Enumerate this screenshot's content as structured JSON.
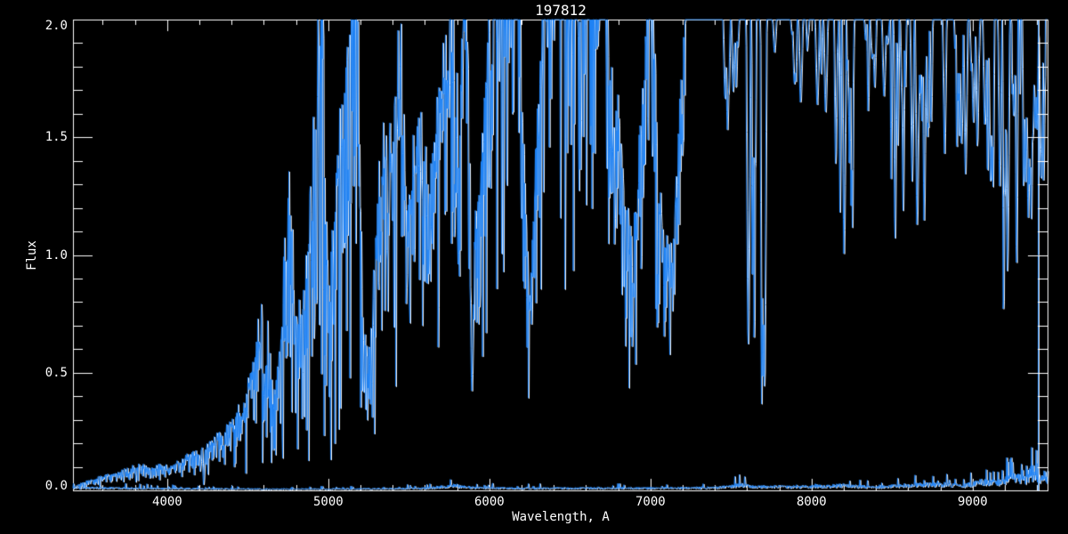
{
  "window": {
    "background_color": "#000000"
  },
  "chart_data": {
    "type": "line",
    "title": "197812",
    "xlabel": "Wavelength, A",
    "ylabel": "Flux",
    "xlim": [
      3415,
      9465
    ],
    "ylim": [
      0,
      2.0
    ],
    "grid": false,
    "legend": null,
    "x_ticks": [
      {
        "value": 4000,
        "label": "4000"
      },
      {
        "value": 5000,
        "label": "5000"
      },
      {
        "value": 6000,
        "label": "6000"
      },
      {
        "value": 7000,
        "label": "7000"
      },
      {
        "value": 8000,
        "label": "8000"
      },
      {
        "value": 9000,
        "label": "9000"
      }
    ],
    "x_minor_step": 200,
    "y_ticks": [
      {
        "value": 0.0,
        "label": "0.0"
      },
      {
        "value": 0.5,
        "label": "0.5"
      },
      {
        "value": 1.0,
        "label": "1.0"
      },
      {
        "value": 1.5,
        "label": "1.5"
      },
      {
        "value": 2.0,
        "label": "2.0"
      }
    ],
    "y_minor_step": 0.1,
    "colors": {
      "background": "#000000",
      "axis": "#FFFFFF",
      "text": "#FFFFFF",
      "spectrum_line": "#1E82F5",
      "underdraw_line": "#FFFFFF"
    },
    "series": [
      {
        "name": "spectrum",
        "clip_max": 2.0,
        "envelope_points": [
          [
            3420,
            0.015
          ],
          [
            3470,
            0.03
          ],
          [
            3540,
            0.045
          ],
          [
            3620,
            0.06
          ],
          [
            3700,
            0.075
          ],
          [
            3780,
            0.095
          ],
          [
            3840,
            0.1
          ],
          [
            3900,
            0.085
          ],
          [
            3950,
            0.105
          ],
          [
            4010,
            0.095
          ],
          [
            4070,
            0.115
          ],
          [
            4130,
            0.14
          ],
          [
            4200,
            0.155
          ],
          [
            4270,
            0.19
          ],
          [
            4340,
            0.23
          ],
          [
            4410,
            0.27
          ],
          [
            4470,
            0.36
          ],
          [
            4530,
            0.48
          ],
          [
            4584,
            0.7
          ],
          [
            4607,
            0.42
          ],
          [
            4626,
            0.7
          ],
          [
            4660,
            0.36
          ],
          [
            4700,
            0.55
          ],
          [
            4761,
            1.3
          ],
          [
            4792,
            0.62
          ],
          [
            4830,
            0.7
          ],
          [
            4880,
            1.05
          ],
          [
            4930,
            1.7
          ],
          [
            4954,
            2.3
          ],
          [
            4978,
            1.1
          ],
          [
            5012,
            0.8
          ],
          [
            5060,
            1.4
          ],
          [
            5120,
            1.85
          ],
          [
            5167,
            2.25
          ],
          [
            5210,
            0.72
          ],
          [
            5252,
            0.54
          ],
          [
            5300,
            1.15
          ],
          [
            5350,
            1.42
          ],
          [
            5400,
            1.28
          ],
          [
            5448,
            1.92
          ],
          [
            5482,
            1.05
          ],
          [
            5530,
            1.35
          ],
          [
            5580,
            1.42
          ],
          [
            5630,
            1.22
          ],
          [
            5680,
            1.52
          ],
          [
            5760,
            1.92
          ],
          [
            5812,
            1.42
          ],
          [
            5850,
            2.35
          ],
          [
            5888,
            0.9
          ],
          [
            5920,
            1.1
          ],
          [
            5970,
            1.62
          ],
          [
            6020,
            2.05
          ],
          [
            6080,
            2.55
          ],
          [
            6158,
            2.85
          ],
          [
            6210,
            1.35
          ],
          [
            6252,
            0.75
          ],
          [
            6300,
            1.6
          ],
          [
            6350,
            2.3
          ],
          [
            6420,
            2.85
          ],
          [
            6458,
            1.95
          ],
          [
            6510,
            2.55
          ],
          [
            6560,
            1.8
          ],
          [
            6600,
            2.75
          ],
          [
            6650,
            2.25
          ],
          [
            6700,
            2.95
          ],
          [
            6742,
            1.55
          ],
          [
            6790,
            1.65
          ],
          [
            6850,
            1.15
          ],
          [
            6882,
            0.95
          ],
          [
            6920,
            1.25
          ],
          [
            6960,
            1.65
          ],
          [
            7000,
            2.35
          ],
          [
            7042,
            1.25
          ],
          [
            7090,
            0.95
          ],
          [
            7140,
            1.05
          ],
          [
            7190,
            1.65
          ],
          [
            7240,
            2.55
          ],
          [
            7300,
            3.2
          ],
          [
            8000,
            3.2
          ],
          [
            8600,
            3.2
          ],
          [
            9000,
            3.2
          ],
          [
            9200,
            3.1
          ],
          [
            9380,
            3.0
          ],
          [
            9407,
            2.8
          ],
          [
            9425,
            2.3
          ],
          [
            9440,
            2.2
          ],
          [
            9455,
            2.4
          ],
          [
            9462,
            2.0
          ]
        ],
        "volatility_points": [
          [
            3420,
            0.45
          ],
          [
            3800,
            0.35
          ],
          [
            4100,
            0.32
          ],
          [
            4400,
            0.38
          ],
          [
            4700,
            0.5
          ],
          [
            5000,
            0.45
          ],
          [
            5300,
            0.42
          ],
          [
            5600,
            0.3
          ],
          [
            5900,
            0.32
          ],
          [
            6200,
            0.35
          ],
          [
            6500,
            0.32
          ],
          [
            6800,
            0.3
          ],
          [
            7100,
            0.28
          ],
          [
            7300,
            0.12
          ],
          [
            7600,
            0.05
          ],
          [
            8000,
            0.035
          ],
          [
            8400,
            0.045
          ],
          [
            8700,
            0.04
          ],
          [
            9000,
            0.05
          ],
          [
            9200,
            0.07
          ],
          [
            9360,
            0.1
          ],
          [
            9460,
            0.25
          ]
        ],
        "deep_lines": [
          {
            "wl": 4225,
            "flux": 0.02
          },
          {
            "wl": 5890,
            "flux": 0.42
          },
          {
            "wl": 8824,
            "flux": 1.43
          },
          {
            "wl": 9190,
            "flux": 0.65
          }
        ],
        "full_height_line_wl": 9407,
        "line_clusters": [
          {
            "from": 7440,
            "to": 7560,
            "count": 7,
            "depth": [
              0.1,
              0.6
            ]
          },
          {
            "from": 7580,
            "to": 7730,
            "count": 16,
            "depth": [
              0.3,
              1.7
            ]
          },
          {
            "from": 7760,
            "to": 8100,
            "count": 11,
            "depth": [
              0.05,
              0.45
            ]
          },
          {
            "from": 8110,
            "to": 8270,
            "count": 12,
            "depth": [
              0.15,
              1.05
            ]
          },
          {
            "from": 8280,
            "to": 8480,
            "count": 9,
            "depth": [
              0.05,
              0.4
            ]
          },
          {
            "from": 8490,
            "to": 8700,
            "count": 15,
            "depth": [
              0.2,
              1.1
            ]
          },
          {
            "from": 8710,
            "to": 8940,
            "count": 9,
            "depth": [
              0.1,
              0.6
            ]
          },
          {
            "from": 8950,
            "to": 9140,
            "count": 12,
            "depth": [
              0.15,
              0.8
            ]
          },
          {
            "from": 9150,
            "to": 9300,
            "count": 10,
            "depth": [
              0.2,
              1.35
            ]
          },
          {
            "from": 9310,
            "to": 9400,
            "count": 14,
            "depth": [
              0.3,
              0.9
            ]
          },
          {
            "from": 9415,
            "to": 9460,
            "count": 6,
            "depth": [
              0.2,
              0.9
            ]
          }
        ]
      },
      {
        "name": "uncertainty",
        "points": [
          [
            3420,
            0.012
          ],
          [
            3700,
            0.01
          ],
          [
            4000,
            0.008
          ],
          [
            4300,
            0.007
          ],
          [
            4800,
            0.006
          ],
          [
            5200,
            0.007
          ],
          [
            5600,
            0.009
          ],
          [
            5780,
            0.02
          ],
          [
            5840,
            0.015
          ],
          [
            5900,
            0.011
          ],
          [
            6200,
            0.009
          ],
          [
            6600,
            0.01
          ],
          [
            7000,
            0.01
          ],
          [
            7400,
            0.012
          ],
          [
            7560,
            0.022
          ],
          [
            7640,
            0.015
          ],
          [
            8000,
            0.016
          ],
          [
            8200,
            0.02
          ],
          [
            8400,
            0.013
          ],
          [
            8600,
            0.022
          ],
          [
            8800,
            0.025
          ],
          [
            8950,
            0.02
          ],
          [
            9050,
            0.035
          ],
          [
            9150,
            0.03
          ],
          [
            9250,
            0.055
          ],
          [
            9330,
            0.045
          ],
          [
            9390,
            0.075
          ],
          [
            9420,
            0.035
          ],
          [
            9445,
            0.06
          ],
          [
            9465,
            0.03
          ]
        ]
      }
    ]
  }
}
